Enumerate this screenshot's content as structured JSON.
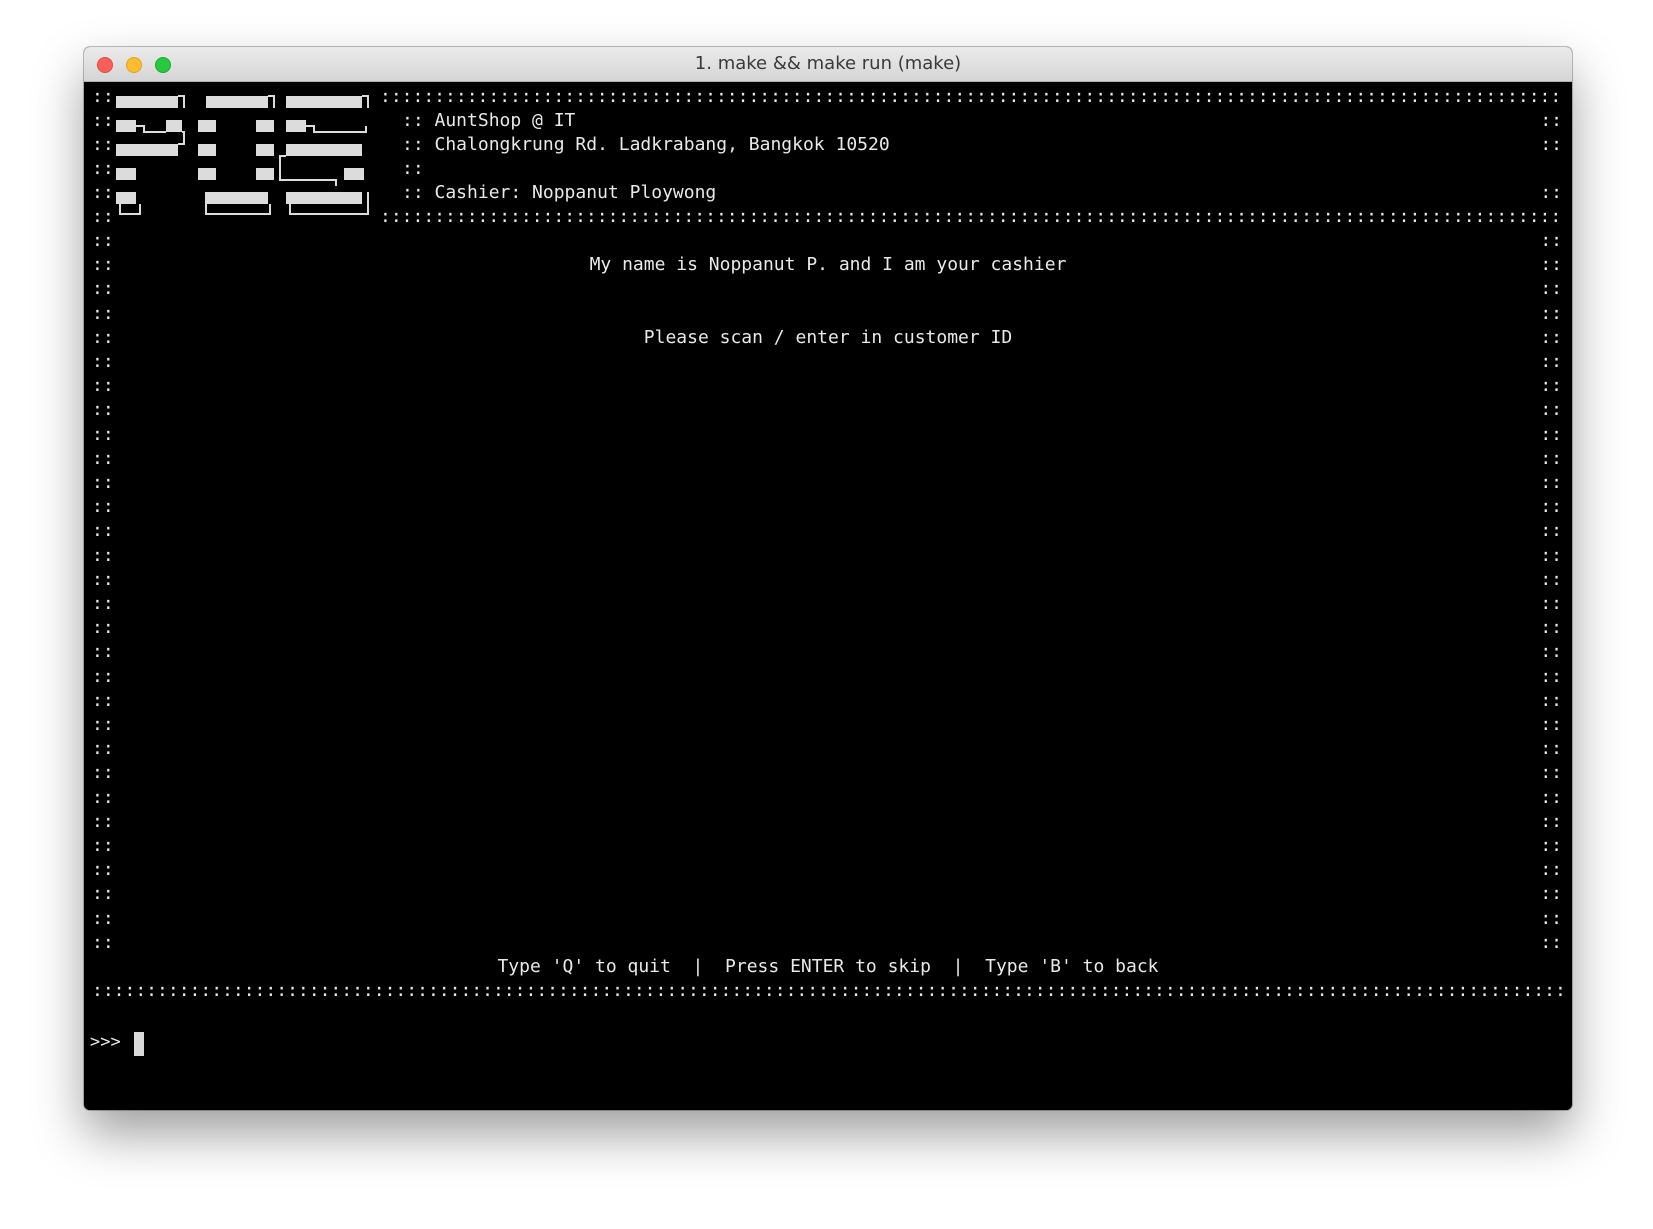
{
  "window": {
    "title": "1. make && make run (make)"
  },
  "header": {
    "logo_text": "POS",
    "shop_name": ":: AuntShop @ IT",
    "address": ":: Chalongkrung Rd. Ladkrabang, Bangkok 10520",
    "blank": "::",
    "cashier": ":: Cashier: Noppanut Ploywong"
  },
  "main": {
    "greeting": "My name is Noppanut P. and I am your cashier",
    "instruction": "Please scan / enter in customer ID"
  },
  "footer": {
    "help": "Type 'Q' to quit  |  Press ENTER to skip  |  Type 'B' to back"
  },
  "prompt": {
    "symbol": ">>>"
  },
  "colors": {
    "terminal_bg": "#000000",
    "terminal_fg": "#e9e9e9"
  }
}
